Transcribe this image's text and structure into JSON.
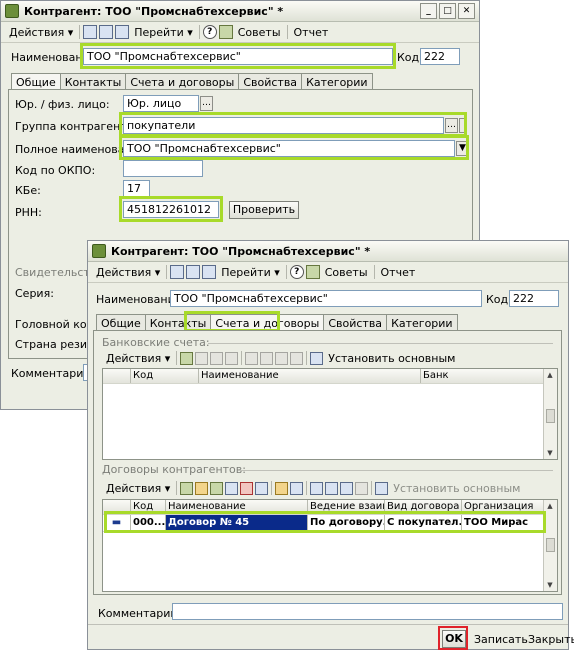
{
  "back_window": {
    "title": "Контрагент: ТОО \"Промснабтехсервис\" *",
    "toolbar": {
      "actions": "Действия ▾",
      "goto": "Перейти ▾",
      "tips": "Советы",
      "report": "Отчет"
    },
    "name_label": "Наименование:",
    "name_value": "ТОО \"Промснабтехсервис\"",
    "code_label": "Код:",
    "code_value": "222",
    "tabs": [
      "Общие",
      "Контакты",
      "Счета и договоры",
      "Свойства",
      "Категории"
    ],
    "fields": {
      "legal_label": "Юр. / физ. лицо:",
      "legal_value": "Юр. лицо",
      "group_label": "Группа контрагентов:",
      "group_value": "покупатели",
      "fullname_label": "Полное наименование:",
      "fullname_value": "ТОО \"Промснабтехсервис\"",
      "okpo_label": "Код по ОКПО:",
      "okpo_value": "",
      "kbe_label": "КБе:",
      "kbe_value": "17",
      "rnn_label": "РНН:",
      "rnn_value": "451812261012",
      "check_button": "Проверить",
      "cert_label": "Свидетельство",
      "series_label": "Серия:",
      "head_label": "Головной контра",
      "country_label": "Страна резидент"
    },
    "comment_label": "Комментарий:"
  },
  "front_window": {
    "title": "Контрагент: ТОО \"Промснабтехсервис\" *",
    "toolbar": {
      "actions": "Действия ▾",
      "goto": "Перейти ▾",
      "tips": "Советы",
      "report": "Отчет"
    },
    "name_label": "Наименование:",
    "name_value": "ТОО \"Промснабтехсервис\"",
    "code_label": "Код:",
    "code_value": "222",
    "tabs": [
      "Общие",
      "Контакты",
      "Счета и договоры",
      "Свойства",
      "Категории"
    ],
    "bank_section": {
      "title": "Банковские счета:",
      "actions": "Действия ▾",
      "set_main": "Установить основным",
      "columns": [
        "Код",
        "Наименование",
        "Банк"
      ]
    },
    "contracts_section": {
      "title": "Договоры контрагентов:",
      "actions": "Действия ▾",
      "set_main": "Установить основным",
      "columns": [
        "Код",
        "Наименование",
        "Ведение взаим...",
        "Вид договора",
        "Организация"
      ],
      "rows": [
        {
          "code": "000...",
          "name": "Договор № 45",
          "mode": "По договору...",
          "kind": "С покупател...",
          "org": "ТОО Мирас"
        }
      ]
    },
    "comment_label": "Комментарий:",
    "buttons": {
      "ok": "OK",
      "save": "Записать",
      "close": "Закрыть"
    }
  },
  "colors": {
    "highlight": "#a8da2a",
    "ok_highlight": "#e0232b",
    "selected_row": "#0a2a8a"
  }
}
